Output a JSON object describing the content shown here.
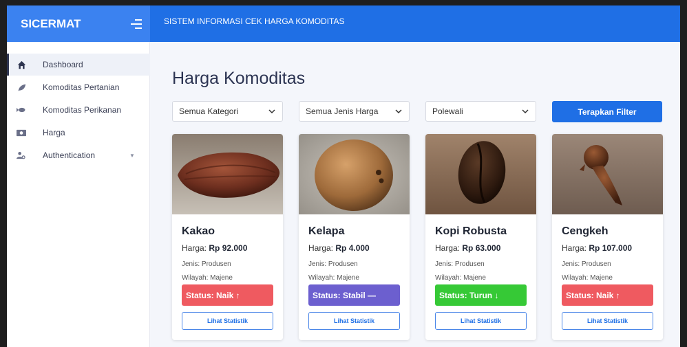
{
  "brand": "SICERMAT",
  "app_title": "SISTEM INFORMASI CEK HARGA KOMODITAS",
  "sidebar": {
    "items": [
      {
        "label": "Dashboard",
        "icon": "home-icon"
      },
      {
        "label": "Komoditas Pertanian",
        "icon": "leaf-icon"
      },
      {
        "label": "Komoditas Perikanan",
        "icon": "fish-icon"
      },
      {
        "label": "Harga",
        "icon": "money-icon"
      },
      {
        "label": "Authentication",
        "icon": "users-icon"
      }
    ]
  },
  "page_title": "Harga Komoditas",
  "filters": {
    "kategori": "Semua Kategori",
    "jenis_harga": "Semua Jenis Harga",
    "wilayah": "Polewali",
    "apply_label": "Terapkan Filter"
  },
  "cards": [
    {
      "name": "Kakao",
      "price_label": "Harga:",
      "price": "Rp 92.000",
      "jenis": "Jenis: Produsen",
      "wilayah": "Wilayah: Majene",
      "status": "Status: Naik ↑",
      "status_color": "#ef5a60",
      "button": "Lihat Statistik"
    },
    {
      "name": "Kelapa",
      "price_label": "Harga:",
      "price": "Rp 4.000",
      "jenis": "Jenis: Produsen",
      "wilayah": "Wilayah: Majene",
      "status": "Status: Stabil —",
      "status_color": "#6c5fcf",
      "button": "Lihat Statistik"
    },
    {
      "name": "Kopi Robusta",
      "price_label": "Harga:",
      "price": "Rp 63.000",
      "jenis": "Jenis: Produsen",
      "wilayah": "Wilayah: Majene",
      "status": "Status: Turun ↓",
      "status_color": "#36c936",
      "button": "Lihat Statistik"
    },
    {
      "name": "Cengkeh",
      "price_label": "Harga:",
      "price": "Rp 107.000",
      "jenis": "Jenis: Produsen",
      "wilayah": "Wilayah: Majene",
      "status": "Status: Naik ↑",
      "status_color": "#ef5a60",
      "button": "Lihat Statistik"
    }
  ],
  "colors": {
    "primary": "#1f6fe5",
    "brand_box": "#3b82f0"
  }
}
